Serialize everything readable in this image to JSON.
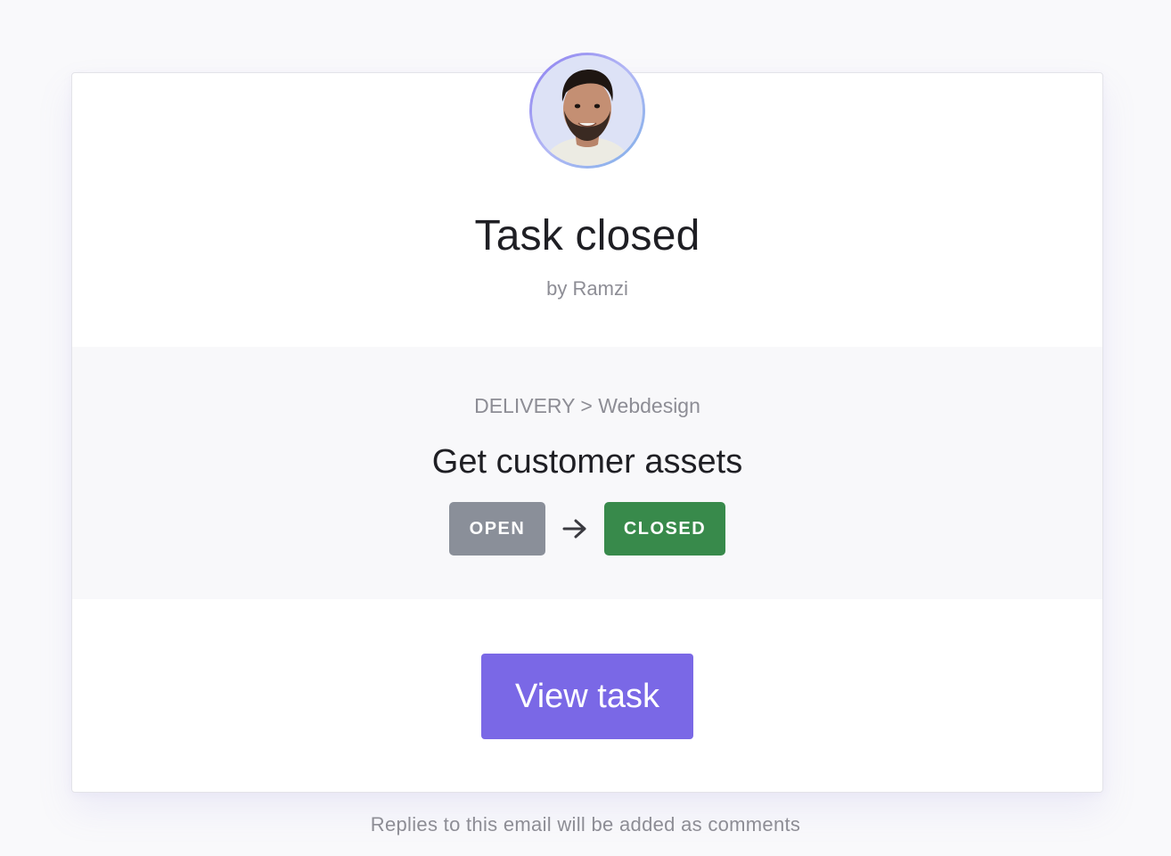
{
  "header": {
    "avatar_icon": "user-avatar-photo",
    "title": "Task closed",
    "byline": "by Ramzi"
  },
  "task": {
    "breadcrumb": "DELIVERY > Webdesign",
    "name": "Get customer assets",
    "status_from": "OPEN",
    "status_to": "CLOSED",
    "arrow_icon": "arrow-right-icon"
  },
  "actions": {
    "view_task_label": "View task"
  },
  "footer": {
    "note": "Replies to this email will be added as comments"
  },
  "colors": {
    "accent": "#7a68e6",
    "status_open": "#8a8f99",
    "status_closed": "#388a4b"
  }
}
